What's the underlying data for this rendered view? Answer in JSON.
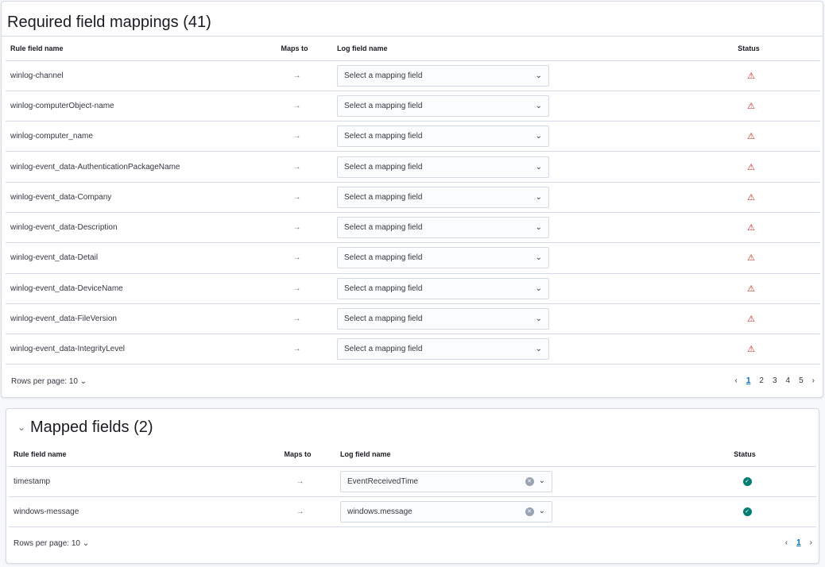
{
  "required": {
    "title": "Required field mappings (41)",
    "columns": [
      "Rule field name",
      "Maps to",
      "Log field name",
      "Status"
    ],
    "rows": [
      {
        "rule": "winlog-channel",
        "placeholder": "Select a mapping field"
      },
      {
        "rule": "winlog-computerObject-name",
        "placeholder": "Select a mapping field"
      },
      {
        "rule": "winlog-computer_name",
        "placeholder": "Select a mapping field"
      },
      {
        "rule": "winlog-event_data-AuthenticationPackageName",
        "placeholder": "Select a mapping field"
      },
      {
        "rule": "winlog-event_data-Company",
        "placeholder": "Select a mapping field"
      },
      {
        "rule": "winlog-event_data-Description",
        "placeholder": "Select a mapping field"
      },
      {
        "rule": "winlog-event_data-Detail",
        "placeholder": "Select a mapping field"
      },
      {
        "rule": "winlog-event_data-DeviceName",
        "placeholder": "Select a mapping field"
      },
      {
        "rule": "winlog-event_data-FileVersion",
        "placeholder": "Select a mapping field"
      },
      {
        "rule": "winlog-event_data-IntegrityLevel",
        "placeholder": "Select a mapping field"
      }
    ],
    "status_icon": "warning-icon",
    "rows_per_page": "Rows per page: 10",
    "pages": [
      "1",
      "2",
      "3",
      "4",
      "5"
    ],
    "current_page": "1"
  },
  "mapped": {
    "title": "Mapped fields (2)",
    "columns": [
      "Rule field name",
      "Maps to",
      "Log field name",
      "Status"
    ],
    "rows": [
      {
        "rule": "timestamp",
        "value": "EventReceivedTime"
      },
      {
        "rule": "windows-message",
        "value": "windows.message"
      }
    ],
    "status_icon": "check-circle-icon",
    "rows_per_page": "Rows per page: 10",
    "pages": [
      "1"
    ],
    "current_page": "1"
  },
  "colors": {
    "warning": "#bd271e",
    "success": "#017d73",
    "link": "#006bb4"
  }
}
